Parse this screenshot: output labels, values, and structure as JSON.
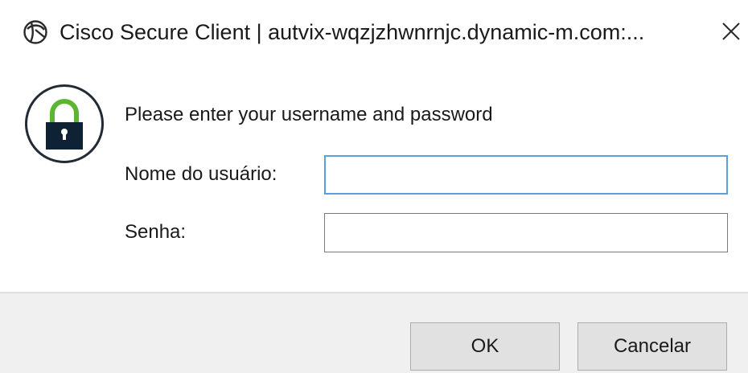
{
  "window": {
    "title": "Cisco Secure Client | autvix-wqzjzhwnrnjc.dynamic-m.com:...",
    "app_icon": "cisco-secure-client-icon",
    "close_icon": "close-icon"
  },
  "dialog": {
    "icon": "lock-icon",
    "prompt": "Please enter your username and password",
    "username": {
      "label": "Nome do usuário:",
      "value": "",
      "placeholder": "",
      "focused": true
    },
    "password": {
      "label": "Senha:",
      "value": "",
      "placeholder": ""
    }
  },
  "buttons": {
    "ok_label": "OK",
    "cancel_label": "Cancelar"
  },
  "colors": {
    "lock_arc": "#5cb531",
    "lock_body": "#0f2235",
    "focus_border": "#5aa0e0",
    "footer_bg": "#f0f0f0"
  }
}
